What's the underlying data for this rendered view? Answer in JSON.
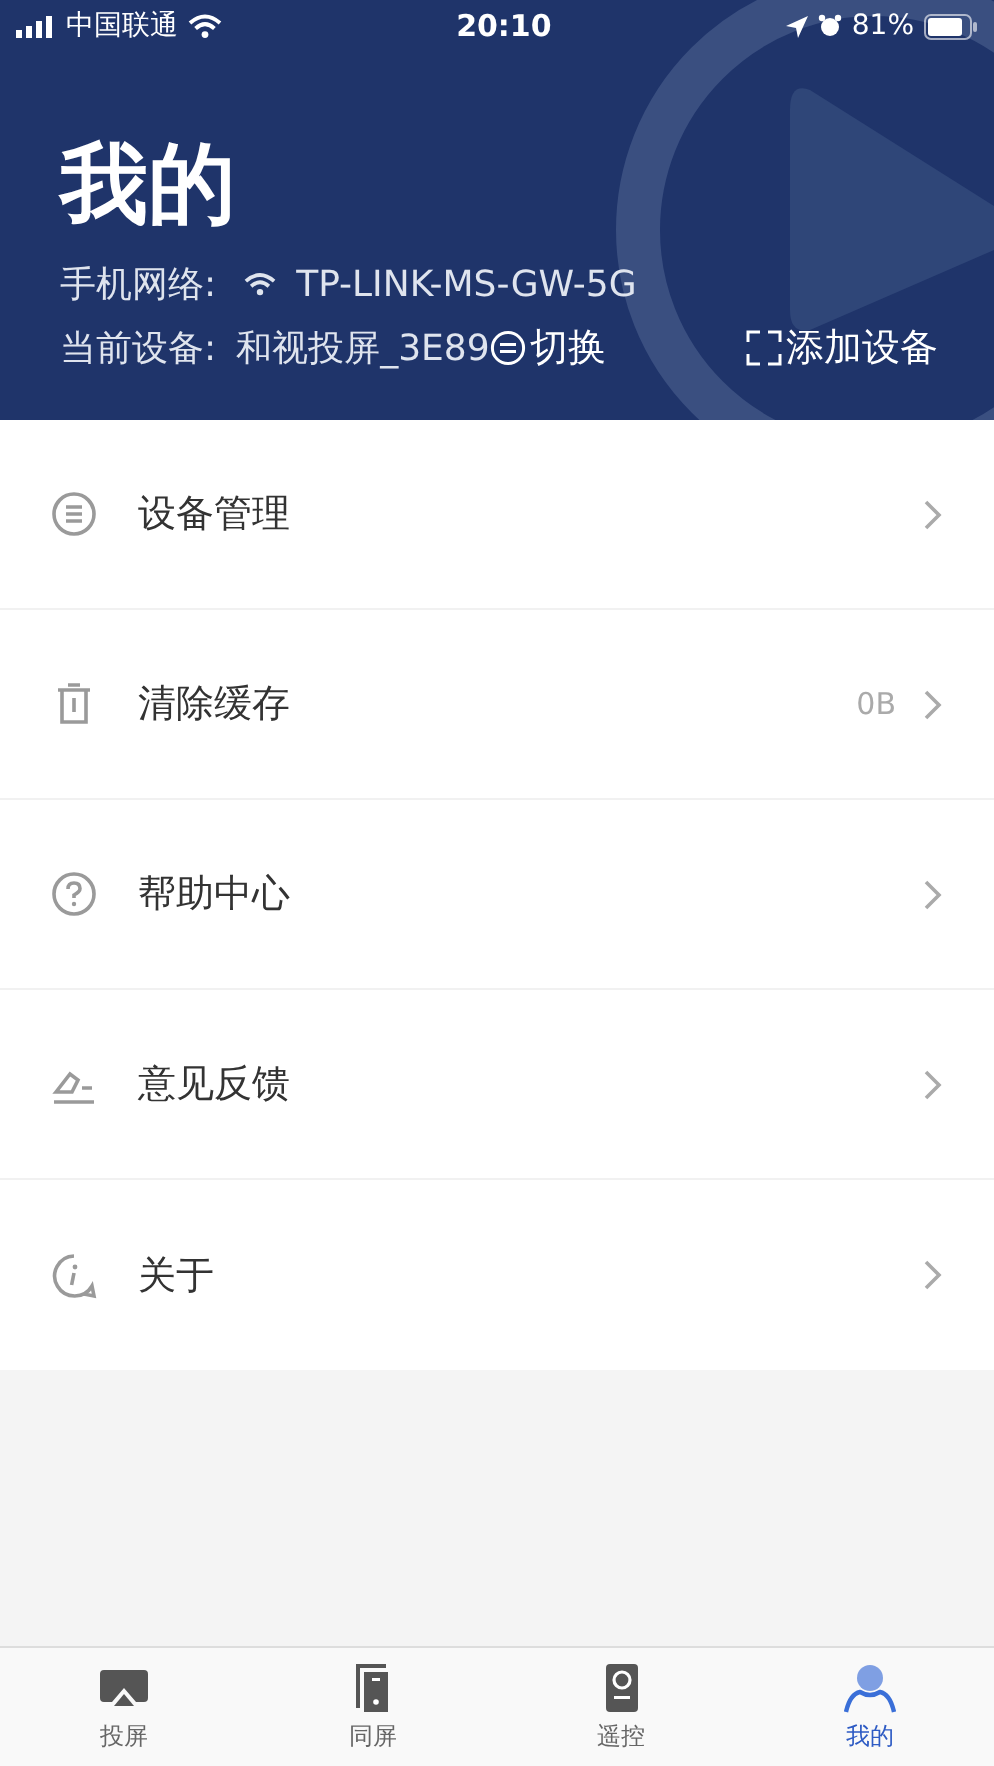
{
  "status_bar": {
    "carrier": "中国联通",
    "time": "20:10",
    "battery": "81%"
  },
  "header": {
    "title": "我的",
    "network_label": "手机网络:",
    "network_name": "TP-LINK-MS-GW-5G",
    "device_label": "当前设备:",
    "device_name": "和视投屏_3E89",
    "switch": "切换",
    "add_device": "添加设备"
  },
  "menu": [
    {
      "kind": "list",
      "label": "设备管理"
    },
    {
      "kind": "trash",
      "label": "清除缓存",
      "value": "0B"
    },
    {
      "kind": "help",
      "label": "帮助中心"
    },
    {
      "kind": "feedback",
      "label": "意见反馈"
    },
    {
      "kind": "info",
      "label": "关于"
    }
  ],
  "tabs": [
    {
      "kind": "cast",
      "label": "投屏",
      "selected": false
    },
    {
      "kind": "mirror",
      "label": "同屏",
      "selected": false
    },
    {
      "kind": "remote",
      "label": "遥控",
      "selected": false
    },
    {
      "kind": "profile",
      "label": "我的",
      "selected": true
    }
  ]
}
